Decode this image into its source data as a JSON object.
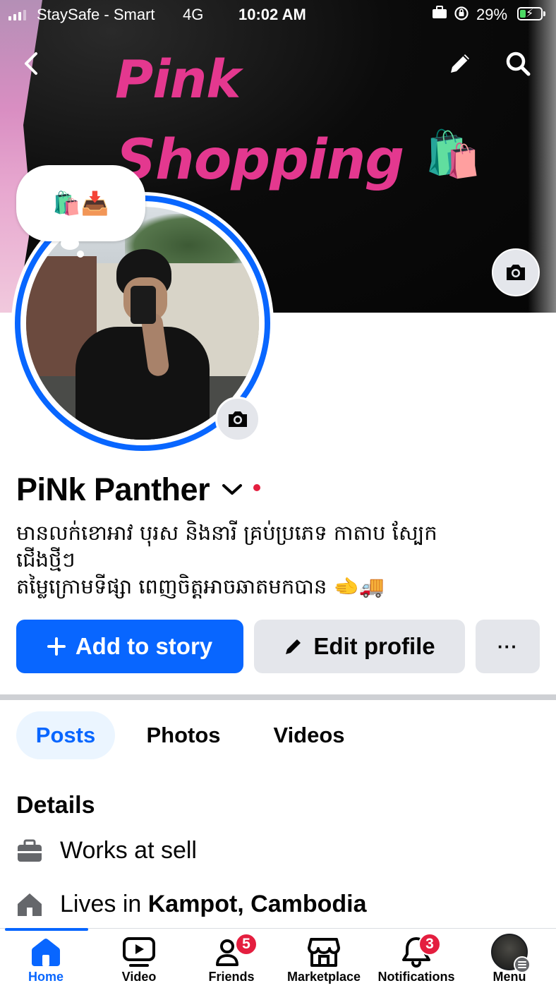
{
  "status_bar": {
    "carrier": "StaySafe - Smart",
    "network": "4G",
    "time": "10:02 AM",
    "battery_percent": "29%",
    "battery_level": 0.29,
    "icons": [
      "signal-icon",
      "briefcase-icon",
      "orientation-lock-icon",
      "battery-charging-icon"
    ]
  },
  "cover": {
    "title_line1": "Pink",
    "title_line2": "Shopping",
    "title_emoji": "🛍️",
    "accent_color": "#e4388f"
  },
  "profile": {
    "note_emojis": "🛍️📥",
    "name": "PiNk Panther",
    "bio_lines": [
      "មានលក់ខោអាវ បុរស និងនារី គ្រប់ប្រភេទ កាតាប ស្បែក",
      "ជើងថ្មីៗ",
      "តម្លៃក្រោមទីផ្សា ពេញចិត្តអាចឆាតមកបាន 🫲🚚"
    ]
  },
  "actions": {
    "add_story": "Add to story",
    "edit_profile": "Edit profile",
    "more": "···"
  },
  "tabs": [
    {
      "label": "Posts",
      "active": true
    },
    {
      "label": "Photos",
      "active": false
    },
    {
      "label": "Videos",
      "active": false
    }
  ],
  "details": {
    "heading": "Details",
    "works_at": "Works at sell",
    "lives_prefix": "Lives in ",
    "lives_place": "Kampot, Cambodia"
  },
  "bottom_nav": [
    {
      "label": "Home",
      "icon": "home-icon",
      "active": true
    },
    {
      "label": "Video",
      "icon": "video-icon",
      "active": false
    },
    {
      "label": "Friends",
      "icon": "friends-icon",
      "badge": "5",
      "active": false
    },
    {
      "label": "Marketplace",
      "icon": "marketplace-icon",
      "active": false
    },
    {
      "label": "Notifications",
      "icon": "bell-icon",
      "badge": "3",
      "active": false
    },
    {
      "label": "Menu",
      "icon": "profile-avatar",
      "active": false
    }
  ],
  "colors": {
    "primary": "#0866ff",
    "badge": "#e41e3f",
    "button_gray": "#e4e6eb",
    "tab_active_bg": "#ebf5ff"
  }
}
